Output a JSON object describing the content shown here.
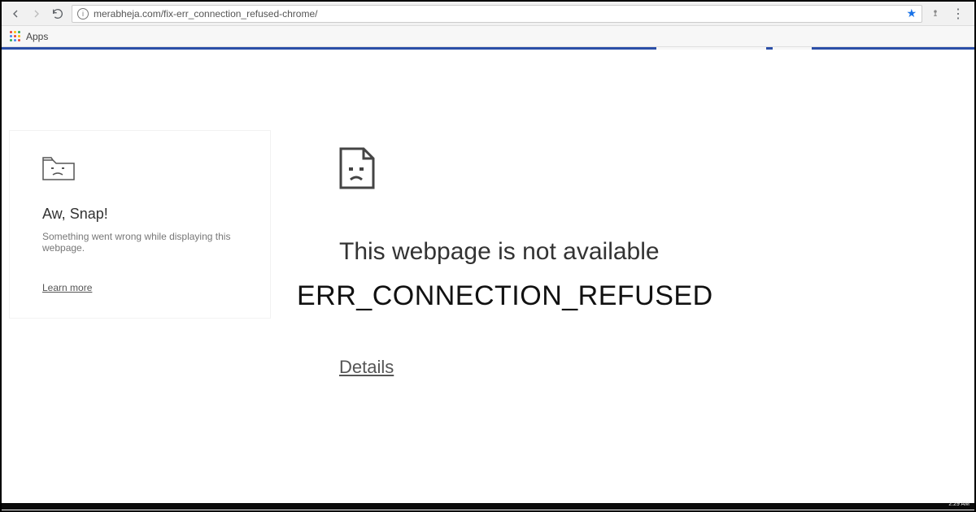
{
  "toolbar": {
    "url": "merabheja.com/fix-err_connection_refused-chrome/"
  },
  "bookmarks": {
    "apps_label": "Apps"
  },
  "snap_card": {
    "title": "Aw, Snap!",
    "subtitle": "Something went wrong while displaying this webpage.",
    "learn_more": "Learn more"
  },
  "main_error": {
    "heading": "This webpage is not available",
    "code": "ERR_CONNECTION_REFUSED",
    "details": "Details"
  },
  "taskbar": {
    "clock": "2:29 AM"
  }
}
